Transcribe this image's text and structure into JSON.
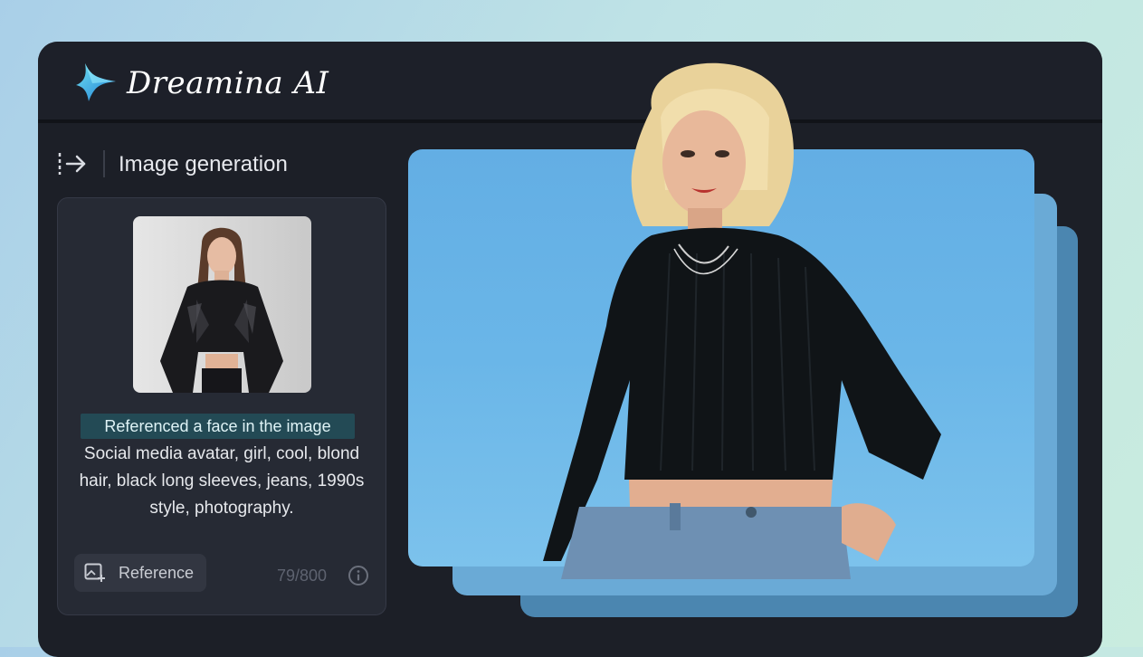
{
  "app": {
    "brand": "Dreamina AI",
    "section_title": "Image generation"
  },
  "panel": {
    "highlight_text": "Referenced a face in the image",
    "prompt_text": "Social media avatar, girl, cool, blond hair, black long sleeves, jeans, 1990s style, photography.",
    "reference_button_label": "Reference",
    "char_counter": "79/800"
  },
  "icons": {
    "logo": "dreamina-star-logo",
    "collapse": "panel-expand-arrow-icon",
    "reference": "image-add-icon",
    "info": "info-icon"
  },
  "colors": {
    "app_bg": "#1c1f27",
    "card_bg": "#262a34",
    "highlight_bg": "#234a55",
    "canvas_blue": "#63aee4",
    "stack_blue_light": "#6aaad6",
    "stack_blue_dark": "#4b86b0"
  }
}
